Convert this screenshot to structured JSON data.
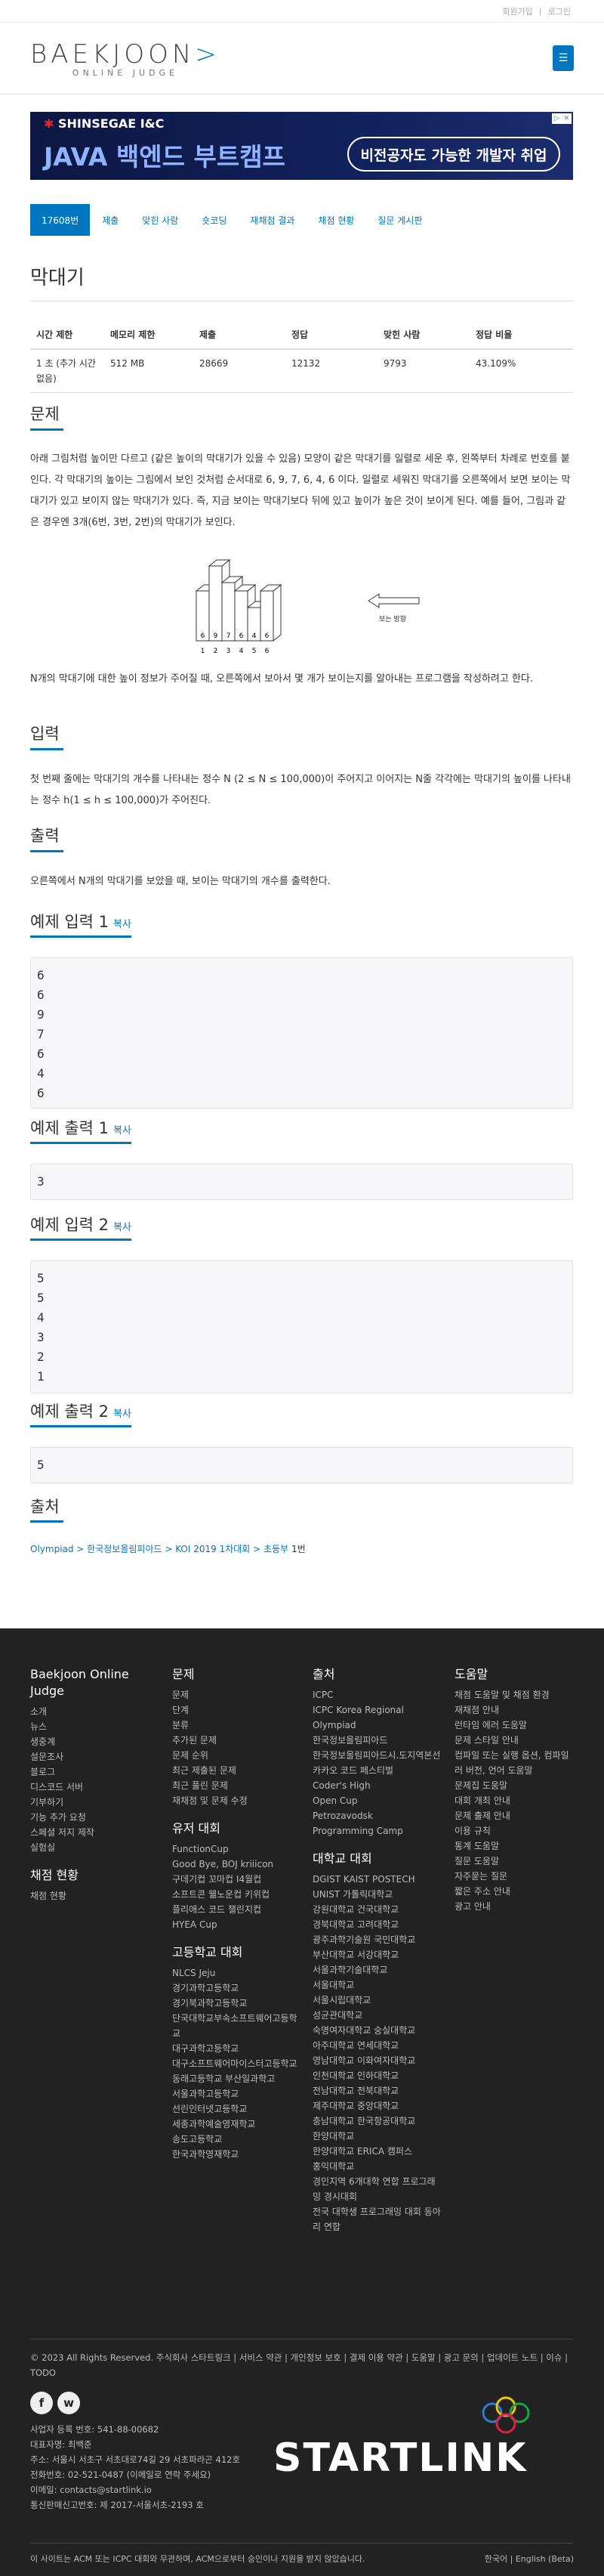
{
  "topbar": {
    "signup": "회원가입",
    "sep": "|",
    "login": "로그인"
  },
  "logo": {
    "main_left": "BAEKJOON",
    "main_right": ">",
    "sub": "ONLINE JUDGE"
  },
  "header": {
    "menu_icon": "bars-icon"
  },
  "ad": {
    "company": "SHINSEGAE I&C",
    "title": "JAVA 백엔드 부트캠프",
    "pill": "비전공자도 가능한 개발자 취업"
  },
  "tabs": [
    "17608번",
    "제출",
    "맞힌 사람",
    "숏코딩",
    "재채점 결과",
    "채점 현황",
    "질문 게시판"
  ],
  "problem_title": "막대기",
  "info": {
    "headers": [
      "시간 제한",
      "메모리 제한",
      "제출",
      "정답",
      "맞힌 사람",
      "정답 비율"
    ],
    "row": [
      "1 초 (추가 시간 없음)",
      "512 MB",
      "28669",
      "12132",
      "9793",
      "43.109%"
    ]
  },
  "sections": {
    "desc_title": "문제",
    "desc1": "아래 그림처럼 높이만 다르고 (같은 높이의 막대기가 있을 수 있음) 모양이 같은 막대기를 일렬로 세운 후, 왼쪽부터 차례로 번호를 붙인다. 각 막대기의 높이는 그림에서 보인 것처럼 순서대로 6, 9, 7, 6, 4, 6 이다. 일렬로 세워진 막대기를 오른쪽에서 보면 보이는 막대기가 있고 보이지 않는 막대기가 있다. 즉, 지금 보이는 막대기보다 뒤에 있고 높이가 높은 것이 보이게 된다. 예를 들어, 그림과 같은 경우엔 3개(6번, 3번, 2번)의 막대기가 보인다.",
    "desc2": "N개의 막대기에 대한 높이 정보가 주어질 때, 오른쪽에서 보아서 몇 개가 보이는지를 알아내는 프로그램을 작성하려고 한다.",
    "input_title": "입력",
    "input_text": "첫 번째 줄에는 막대기의 개수를 나타내는 정수 N (2 ≤ N ≤ 100,000)이 주어지고 이어지는 N줄 각각에는 막대기의 높이를 나타내는 정수 h(1 ≤ h ≤ 100,000)가 주어진다.",
    "output_title": "출력",
    "output_text": "오른쪽에서 N개의 막대기를 보았을 때, 보이는 막대기의 개수를 출력한다.",
    "source_title": "출처"
  },
  "figure": {
    "bar_labels": [
      "6",
      "9",
      "7",
      "6",
      "4",
      "6"
    ],
    "indices": [
      "1",
      "2",
      "3",
      "4",
      "5",
      "6"
    ],
    "heights": [
      6,
      9,
      7,
      6,
      4,
      6
    ],
    "view": "보는 방향"
  },
  "samples": {
    "copy": "복사",
    "in1_title": "예제 입력 1",
    "in1": [
      "6",
      "6",
      "9",
      "7",
      "6",
      "4",
      "6"
    ],
    "out1_title": "예제 출력 1",
    "out1": [
      "3"
    ],
    "in2_title": "예제 입력 2",
    "in2": [
      "5",
      "5",
      "4",
      "3",
      "2",
      "1"
    ],
    "out2_title": "예제 출력 2",
    "out2": [
      "5"
    ]
  },
  "source": {
    "path": "Olympiad > 한국정보올림피아드 > KOI 2019 1차대회 > 초등부",
    "tail": "1번"
  },
  "footer": {
    "col1_title": "Baekjoon Online Judge",
    "col1": [
      "소개",
      "뉴스",
      "생중계",
      "설문조사",
      "블로그",
      "디스코드 서버",
      "기부하기",
      "기능 추가 요청",
      "스페셜 저지 제작",
      "실험실"
    ],
    "col1b_title": "채점 현황",
    "col1b": [
      "채점 현황"
    ],
    "col2_title": "문제",
    "col2": [
      "문제",
      "단계",
      "분류",
      "추가된 문제",
      "문제 순위",
      "최근 제출된 문제",
      "최근 풀린 문제",
      "재채점 및 문제 수정"
    ],
    "col2b_title": "유저 대회",
    "col2b": [
      "FunctionCup",
      "Good Bye, BOJ kriiicon",
      "구데기컵 꼬마컵 I4월컵",
      "소프트콘 웰노운컵 키위컵",
      "플리애스 코드 챌린지컵",
      "HYEA Cup"
    ],
    "col2c_title": "고등학교 대회",
    "col2c": [
      "NLCS Jeju",
      "경기과학고등학교",
      "경기북과학고등학교",
      "단국대학교부속소프트웨어고등학교",
      "대구과학고등학교",
      "대구소프트웨어마이스터고등학교",
      "동래고등학교 부산일과학고",
      "서울과학고등학교",
      "선린인터넷고등학교",
      "세종과학예술영재학교",
      "송도고등학교",
      "한국과학영재학교"
    ],
    "col3_title": "출처",
    "col3": [
      "ICPC",
      "ICPC Korea Regional",
      "Olympiad",
      "한국정보올림피아드",
      "한국정보올림피아드시.도지역본선",
      "카카오 코드 페스티벌",
      "Coder's High",
      "Open Cup",
      "Petrozavodsk",
      "Programming Camp"
    ],
    "col3b_title": "대학교 대회",
    "col3b": [
      "DGIST KAIST POSTECH",
      "UNIST 가톨릭대학교",
      "강원대학교 건국대학교",
      "경북대학교 고려대학교",
      "광주과학기술원 국민대학교",
      "부산대학교 서강대학교",
      "서울과학기술대학교",
      "서울대학교",
      "서울시립대학교",
      "성균관대학교",
      "숙명여자대학교 숭실대학교",
      "아주대학교 연세대학교",
      "영남대학교 이화여자대학교",
      "인천대학교 인하대학교",
      "전남대학교 전북대학교",
      "제주대학교 중앙대학교",
      "충남대학교 한국항공대학교",
      "한양대학교",
      "한양대학교 ERICA 캠퍼스",
      "홍익대학교",
      "경인지역 6개대학 연합 프로그래밍 경시대회",
      "전국 대학생 프로그래밍 대회 동아리 연합"
    ],
    "col4_title": "도움말",
    "col4": [
      "채점 도움말 및 채점 환경",
      "재채점 안내",
      "런타임 에러 도움말",
      "문제 스타일 안내",
      "컴파일 또는 실행 옵션, 컴파일러 버전, 언어 도움말",
      "문제집 도움말",
      "대회 개최 안내",
      "문제 출제 안내",
      "이용 규칙",
      "통계 도움말",
      "질문 도움말",
      "자주묻는 질문",
      "짧은 주소 안내",
      "광고 안내"
    ],
    "copyright": "© 2023 All Rights Reserved. 주식회사 스타트링크 | 서비스 약관 | 개인정보 보호 | 결제 이용 약관 | 도움말 | 광고 문의 | 업데이트 노트 | 이슈 | TODO",
    "social": [
      "f",
      "w"
    ],
    "biz": [
      "사업자 등록 번호: 541-88-00682",
      "대표자명: 최백준",
      "주소: 서울시 서초구 서초대로74길 29 서초파라곤 412호",
      "전화번호: 02-521-0487 (이메일로 연락 주세요)",
      "이메일: contacts@startlink.io",
      "통신판매신고번호: 제 2017-서울서초-2193 호"
    ],
    "startlink": "STARTLINK",
    "notice": "이 사이트는 ACM 또는 ICPC 대회와 무관하며, ACM으로부터 승인이나 지원을 받지 않았습니다.",
    "lang": "한국어 | English (Beta)"
  }
}
